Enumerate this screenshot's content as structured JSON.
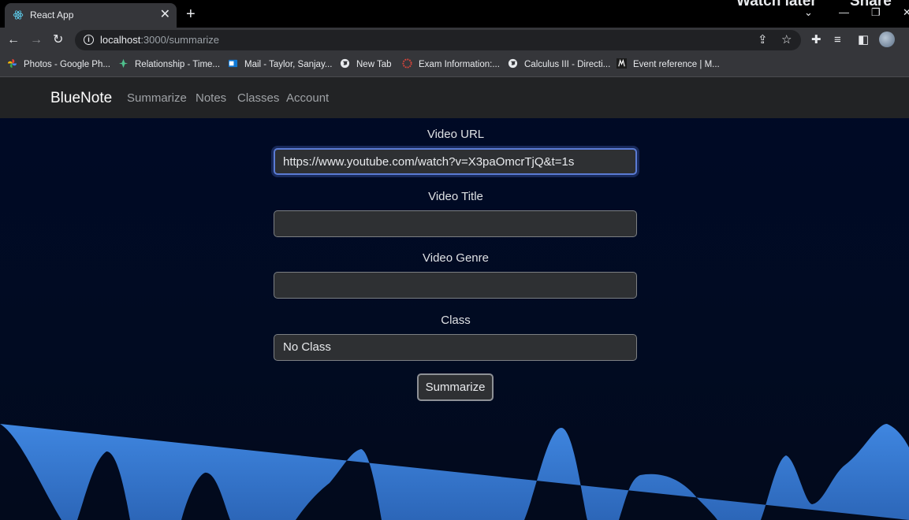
{
  "browser": {
    "tab": {
      "title": "React App"
    },
    "overlay": {
      "watch_later": "Watch later",
      "share": "Share"
    },
    "address": {
      "host": "localhost",
      "path": ":3000/summarize"
    },
    "bookmarks": [
      {
        "label": "Photos - Google Ph...",
        "icon": "google-photos-icon"
      },
      {
        "label": "Relationship - Time...",
        "icon": "leaf-icon"
      },
      {
        "label": "Mail - Taylor, Sanjay...",
        "icon": "outlook-icon"
      },
      {
        "label": "New Tab",
        "icon": "globe-icon"
      },
      {
        "label": "Exam Information:...",
        "icon": "exam-icon"
      },
      {
        "label": "Calculus III - Directi...",
        "icon": "globe-icon"
      },
      {
        "label": "Event reference | M...",
        "icon": "mdn-icon"
      }
    ]
  },
  "app": {
    "brand": "BlueNote",
    "nav": [
      "Summarize",
      "Notes",
      "Classes",
      "Account"
    ],
    "form": {
      "video_url": {
        "label": "Video URL",
        "value": "https://www.youtube.com/watch?v=X3paOmcrTjQ&t=1s"
      },
      "video_title": {
        "label": "Video Title",
        "value": ""
      },
      "video_genre": {
        "label": "Video Genre",
        "value": ""
      },
      "class": {
        "label": "Class",
        "value": "No Class"
      },
      "submit_label": "Summarize"
    }
  },
  "colors": {
    "page_bg": "#000a26",
    "wave": "#3d7fd6",
    "nav_bg": "#222325"
  }
}
